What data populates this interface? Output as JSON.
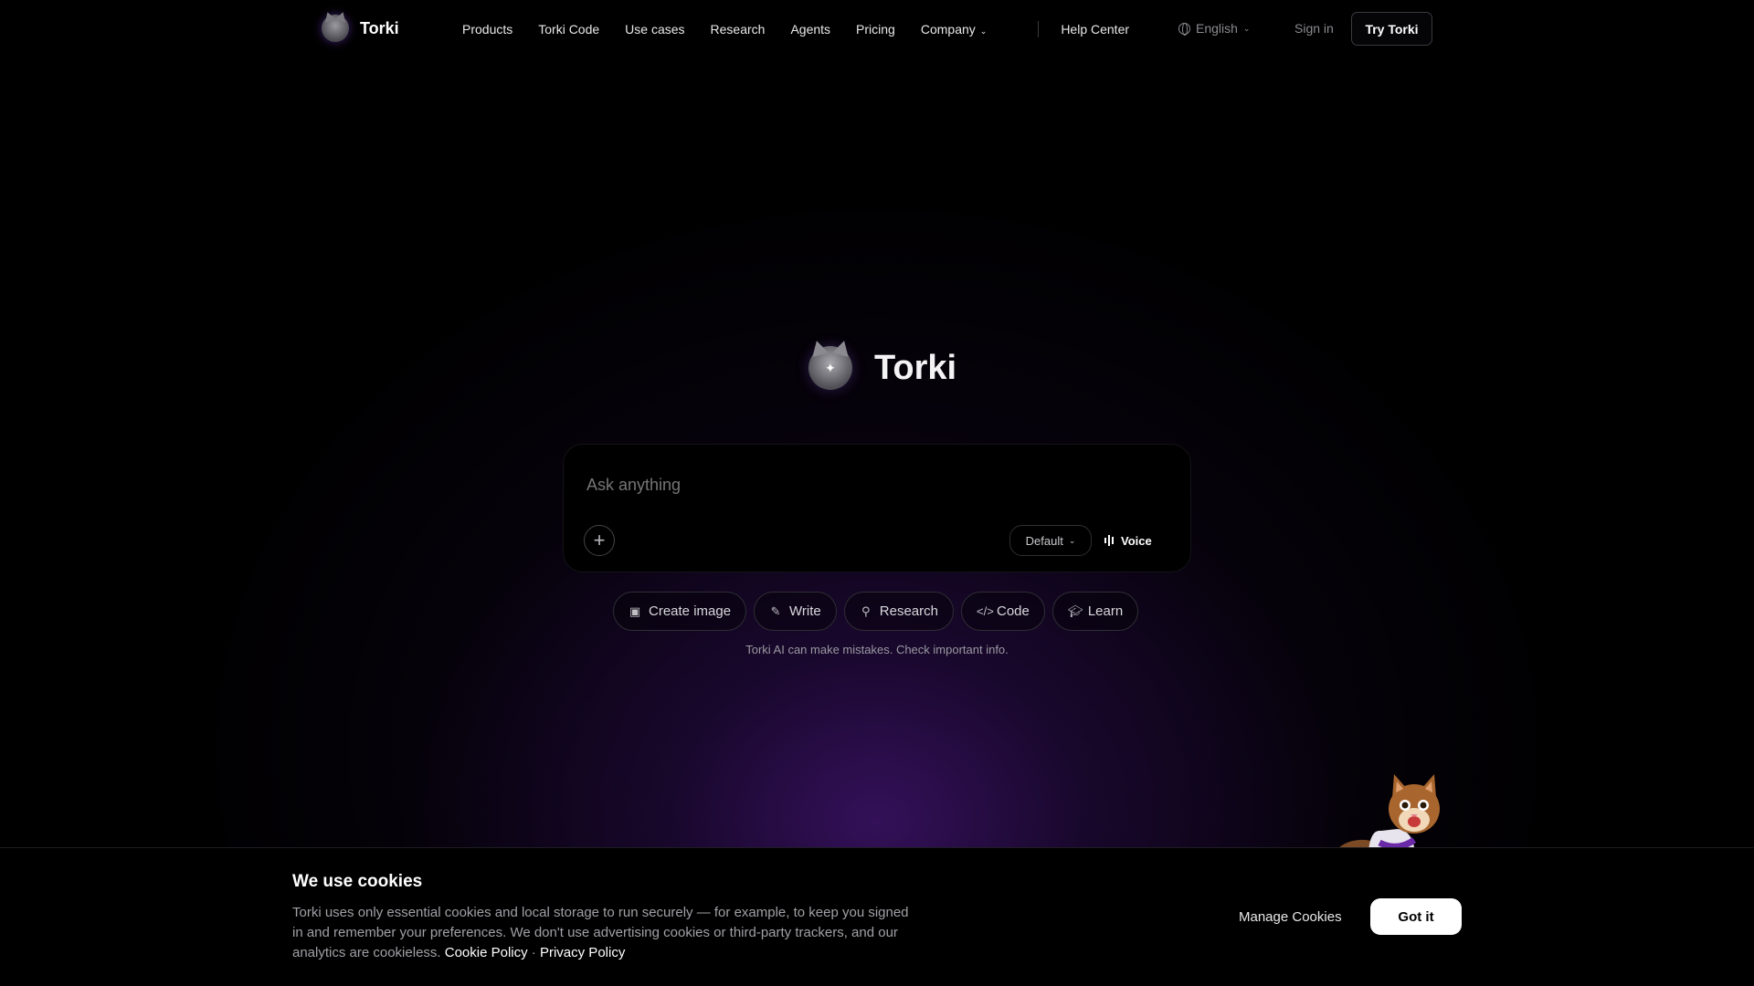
{
  "nav": {
    "brand": "Torki",
    "links": [
      "Products",
      "Torki Code",
      "Use cases",
      "Research",
      "Agents",
      "Pricing"
    ],
    "company": "Company",
    "help": "Help Center",
    "language": "English",
    "signin": "Sign in",
    "try": "Try Torki"
  },
  "hero": {
    "title": "Torki"
  },
  "input": {
    "placeholder": "Ask anything",
    "model": "Default",
    "voice": "Voice"
  },
  "chips": [
    "Create image",
    "Write",
    "Research",
    "Code",
    "Learn"
  ],
  "disclaimer": "Torki AI can make mistakes. Check important info.",
  "cookie": {
    "title": "We use cookies",
    "body": "Torki uses only essential cookies and local storage to run securely — for example, to keep you signed in and remember your preferences. We don't use advertising cookies or third-party trackers, and our analytics are cookieless.",
    "cookie_policy": "Cookie Policy",
    "separator": "·",
    "privacy_policy": "Privacy Policy",
    "manage": "Manage Cookies",
    "accept": "Got it"
  },
  "colors": {
    "accent": "#4a1a8a",
    "background": "#000000"
  }
}
